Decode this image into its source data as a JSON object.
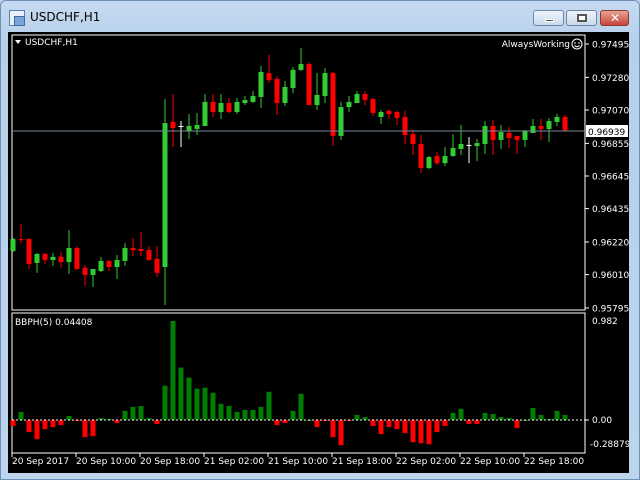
{
  "window": {
    "title": "USDCHF,H1",
    "buttons": [
      "minimize",
      "restore",
      "close"
    ]
  },
  "chart_label": "USDCHF,H1",
  "expert_label": "AlwaysWorking",
  "colors": {
    "bull": "#32cd32",
    "bear": "#ff0000",
    "doji": "#ffffff",
    "hist_up": "#008000",
    "hist_down": "#ff0000",
    "bid_line": "#778899"
  },
  "price_axis": {
    "ticks": [
      "0.97495",
      "0.97280",
      "0.97070",
      "0.96855",
      "0.96645",
      "0.96435",
      "0.96220",
      "0.96010",
      "0.95795"
    ],
    "current_price": "0.96939"
  },
  "indicator": {
    "label": "BBPH(5) 0.04408",
    "axis_ticks": [
      "0.982",
      "0.00",
      "-0.28879"
    ]
  },
  "time_axis": [
    "20 Sep 2017",
    "20 Sep 10:00",
    "20 Sep 18:00",
    "21 Sep 02:00",
    "21 Sep 10:00",
    "21 Sep 18:00",
    "22 Sep 02:00",
    "22 Sep 10:00",
    "22 Sep 18:00"
  ],
  "chart_data": [
    {
      "type": "candlestick",
      "title": "USDCHF,H1",
      "ylim": [
        0.95782,
        0.97553
      ],
      "current_price": 0.96939,
      "ohlc": [
        [
          0.96162,
          0.96246,
          0.96156,
          0.96239
        ],
        [
          0.96239,
          0.96336,
          0.96213,
          0.96233
        ],
        [
          0.96239,
          0.96246,
          0.96046,
          0.96078
        ],
        [
          0.96085,
          0.96149,
          0.96021,
          0.96143
        ],
        [
          0.96143,
          0.96149,
          0.96078,
          0.96104
        ],
        [
          0.96104,
          0.96149,
          0.96066,
          0.96124
        ],
        [
          0.96124,
          0.96156,
          0.96053,
          0.96091
        ],
        [
          0.96091,
          0.96297,
          0.96014,
          0.96181
        ],
        [
          0.96181,
          0.96194,
          0.9604,
          0.96046
        ],
        [
          0.96053,
          0.96072,
          0.95937,
          0.96008
        ],
        [
          0.96008,
          0.96046,
          0.9593,
          0.96046
        ],
        [
          0.96033,
          0.96124,
          0.96027,
          0.96098
        ],
        [
          0.96098,
          0.96104,
          0.96033,
          0.96059
        ],
        [
          0.96059,
          0.96136,
          0.95982,
          0.96104
        ],
        [
          0.96098,
          0.96213,
          0.96066,
          0.96181
        ],
        [
          0.96181,
          0.96246,
          0.9613,
          0.96168
        ],
        [
          0.96175,
          0.96284,
          0.9613,
          0.96162
        ],
        [
          0.96168,
          0.96194,
          0.96098,
          0.96104
        ],
        [
          0.96111,
          0.96194,
          0.95995,
          0.96021
        ],
        [
          0.96059,
          0.97141,
          0.95814,
          0.96986
        ],
        [
          0.96993,
          0.97173,
          0.96832,
          0.96954
        ],
        [
          0.96967,
          0.96999,
          0.96832,
          0.96967
        ],
        [
          0.96935,
          0.97044,
          0.96883,
          0.96967
        ],
        [
          0.96948,
          0.97051,
          0.96909,
          0.96973
        ],
        [
          0.96967,
          0.97173,
          0.96967,
          0.97122
        ],
        [
          0.97122,
          0.97173,
          0.97025,
          0.97057
        ],
        [
          0.97057,
          0.97173,
          0.97012,
          0.97115
        ],
        [
          0.97115,
          0.97147,
          0.97051,
          0.97057
        ],
        [
          0.97057,
          0.97147,
          0.97044,
          0.97122
        ],
        [
          0.97115,
          0.9716,
          0.97102,
          0.97134
        ],
        [
          0.97122,
          0.97192,
          0.97115,
          0.9716
        ],
        [
          0.97154,
          0.97353,
          0.97083,
          0.97315
        ],
        [
          0.97308,
          0.97424,
          0.97244,
          0.97263
        ],
        [
          0.9727,
          0.97289,
          0.97038,
          0.97115
        ],
        [
          0.97115,
          0.97257,
          0.97096,
          0.97218
        ],
        [
          0.97212,
          0.97347,
          0.97179,
          0.97328
        ],
        [
          0.97328,
          0.97469,
          0.97321,
          0.97366
        ],
        [
          0.97366,
          0.97379,
          0.97102,
          0.97102
        ],
        [
          0.97102,
          0.97308,
          0.9707,
          0.97167
        ],
        [
          0.9716,
          0.9734,
          0.97115,
          0.97308
        ],
        [
          0.97308,
          0.97315,
          0.96838,
          0.96903
        ],
        [
          0.96903,
          0.97122,
          0.96877,
          0.97089
        ],
        [
          0.97089,
          0.9716,
          0.97057,
          0.97122
        ],
        [
          0.97115,
          0.97192,
          0.97115,
          0.97173
        ],
        [
          0.97173,
          0.97192,
          0.97102,
          0.97134
        ],
        [
          0.97141,
          0.97147,
          0.97031,
          0.97051
        ],
        [
          0.97025,
          0.9707,
          0.9698,
          0.97057
        ],
        [
          0.97064,
          0.97076,
          0.97012,
          0.97044
        ],
        [
          0.97057,
          0.97064,
          0.96973,
          0.97018
        ],
        [
          0.97025,
          0.97064,
          0.96851,
          0.96909
        ],
        [
          0.96915,
          0.96941,
          0.9678,
          0.96851
        ],
        [
          0.96851,
          0.96909,
          0.96664,
          0.96696
        ],
        [
          0.96696,
          0.96774,
          0.9669,
          0.96767
        ],
        [
          0.96774,
          0.968,
          0.96716,
          0.96728
        ],
        [
          0.96728,
          0.96832,
          0.96709,
          0.96774
        ],
        [
          0.96774,
          0.96915,
          0.96767,
          0.96825
        ],
        [
          0.96819,
          0.96973,
          0.9678,
          0.96851
        ],
        [
          0.96845,
          0.96896,
          0.96728,
          0.96845
        ],
        [
          0.96838,
          0.96883,
          0.96741,
          0.96857
        ],
        [
          0.96851,
          0.96999,
          0.96787,
          0.96967
        ],
        [
          0.96967,
          0.97006,
          0.9678,
          0.96877
        ],
        [
          0.96877,
          0.96973,
          0.96819,
          0.96928
        ],
        [
          0.96922,
          0.9696,
          0.96825,
          0.9689
        ],
        [
          0.96903,
          0.96903,
          0.96787,
          0.96877
        ],
        [
          0.96877,
          0.96941,
          0.96832,
          0.96935
        ],
        [
          0.96922,
          0.97012,
          0.96922,
          0.96967
        ],
        [
          0.96967,
          0.97012,
          0.96877,
          0.96948
        ],
        [
          0.96948,
          0.97018,
          0.96864,
          0.96999
        ],
        [
          0.96993,
          0.97044,
          0.96967,
          0.97025
        ],
        [
          0.97025,
          0.97038,
          0.96935,
          0.96939
        ]
      ]
    },
    {
      "type": "bar",
      "title": "BBPH(5)",
      "ylim": [
        -0.327,
        1.061
      ],
      "values": [
        -0.06,
        0.08,
        -0.12,
        -0.19,
        -0.09,
        -0.07,
        -0.05,
        0.04,
        -0.01,
        -0.17,
        -0.16,
        0.02,
        0.01,
        -0.03,
        0.09,
        0.13,
        0.14,
        0.02,
        -0.04,
        0.34,
        0.982,
        0.52,
        0.42,
        0.31,
        0.32,
        0.27,
        0.16,
        0.14,
        0.08,
        0.1,
        0.1,
        0.13,
        0.28,
        -0.05,
        -0.03,
        0.09,
        0.26,
        0.0,
        -0.07,
        -0.01,
        -0.17,
        -0.25,
        -0.01,
        0.05,
        0.03,
        -0.06,
        -0.14,
        -0.07,
        -0.09,
        -0.13,
        -0.22,
        -0.23,
        -0.24,
        -0.12,
        -0.06,
        0.07,
        0.11,
        -0.04,
        -0.04,
        0.07,
        0.06,
        0.03,
        0.02,
        -0.08,
        0.0,
        0.12,
        0.05,
        0.01,
        0.09,
        0.05
      ]
    }
  ]
}
